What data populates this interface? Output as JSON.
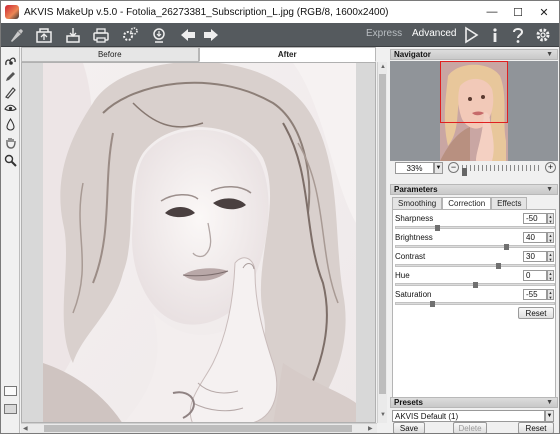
{
  "window": {
    "title": "AKVIS MakeUp v.5.0 - Fotolia_26273381_Subscription_L.jpg (RGB/8, 1600x2400)",
    "minimize_glyph": "—",
    "maximize_glyph": "☐",
    "close_glyph": "✕"
  },
  "toolbar": {
    "modes": {
      "express": "Express",
      "advanced": "Advanced"
    },
    "icons": [
      "open-icon",
      "save-icon",
      "print-icon",
      "batch-icon",
      "publish-icon",
      "back-arrow-icon",
      "forward-arrow-icon",
      "run-icon",
      "info-icon",
      "help-icon",
      "preferences-icon"
    ],
    "accent": "#555a5e"
  },
  "view_tabs": {
    "before": "Before",
    "after": "After",
    "selected": "After"
  },
  "tools": [
    "retouch-brush-icon",
    "pencil-icon",
    "eraser-icon",
    "eye-icon",
    "drop-icon",
    "hand-icon",
    "zoom-icon"
  ],
  "navigator": {
    "title": "Navigator",
    "zoom": "33%",
    "minus": "−",
    "plus": "+"
  },
  "parameters": {
    "title": "Parameters",
    "tabs": [
      "Smoothing",
      "Correction",
      "Effects"
    ],
    "selected_tab": "Correction",
    "rows": [
      {
        "label": "Sharpness",
        "value": "-50",
        "level": 0.25
      },
      {
        "label": "Brightness",
        "value": "40",
        "level": 0.7
      },
      {
        "label": "Contrast",
        "value": "30",
        "level": 0.65
      },
      {
        "label": "Hue",
        "value": "0",
        "level": 0.5
      },
      {
        "label": "Saturation",
        "value": "-55",
        "level": 0.22
      }
    ],
    "reset": "Reset"
  },
  "presets": {
    "title": "Presets",
    "selected": "AKVIS Default (1)",
    "save": "Save",
    "delete": "Delete",
    "reset": "Reset"
  }
}
